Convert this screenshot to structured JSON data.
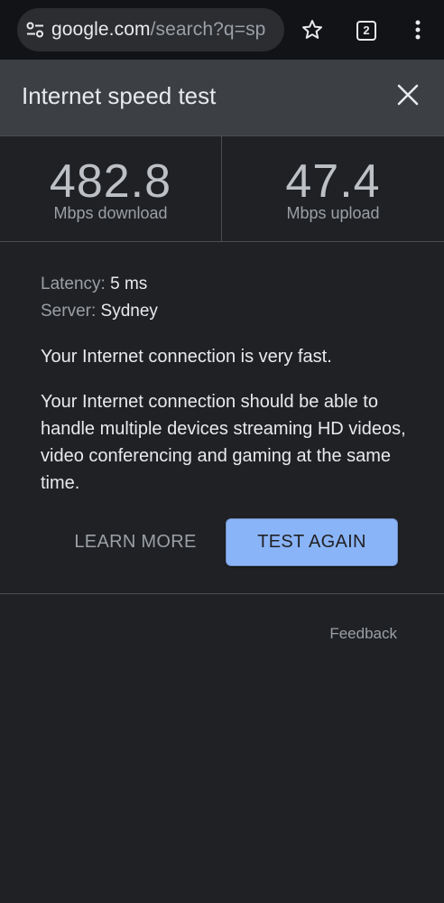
{
  "browser": {
    "url_host": "google.com",
    "url_path": "/search?q=sp",
    "tab_count": "2"
  },
  "card": {
    "title": "Internet speed test"
  },
  "results": {
    "download_value": "482.8",
    "download_label": "Mbps download",
    "upload_value": "47.4",
    "upload_label": "Mbps upload"
  },
  "details": {
    "latency_key": "Latency:",
    "latency_value": "5 ms",
    "server_key": "Server:",
    "server_value": "Sydney",
    "status": "Your Internet connection is very fast.",
    "description": "Your Internet connection should be able to handle multiple devices streaming HD videos, video conferencing and gaming at the same time."
  },
  "actions": {
    "learn_more": "LEARN MORE",
    "test_again": "TEST AGAIN"
  },
  "footer": {
    "feedback": "Feedback"
  },
  "colors": {
    "background": "#202124",
    "header": "#3c3f43",
    "accent_button": "#8ab4f8"
  }
}
